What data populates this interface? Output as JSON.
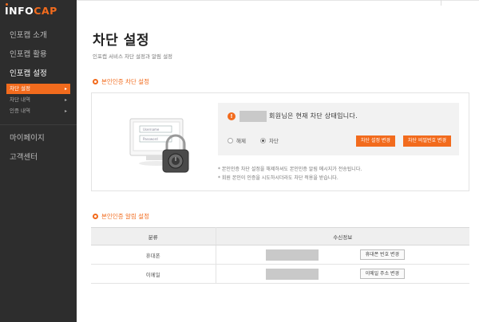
{
  "logo": {
    "prefix": "INFO",
    "suffix": "CAP"
  },
  "nav": {
    "items": [
      {
        "label": "인포캡 소개"
      },
      {
        "label": "인포캡 활용"
      },
      {
        "label": "인포캡 설정"
      }
    ],
    "sub_items": [
      {
        "label": "차단 설정",
        "arrow": "▸"
      },
      {
        "label": "차단 내역",
        "arrow": "▸"
      },
      {
        "label": "인증 내역",
        "arrow": "▸"
      }
    ],
    "bottom_items": [
      {
        "label": "마이페이지"
      },
      {
        "label": "고객센터"
      }
    ]
  },
  "page": {
    "title": "차단 설정",
    "subtitle": "인포캡 서비스 차단 설정과 알림 설정"
  },
  "block_section": {
    "title": "본인인증 차단 설정",
    "alert_icon": "!",
    "status_text": "회원님은 현재 차단 상태입니다.",
    "radio_release": "해제",
    "radio_block": "차단",
    "btn_change_setting": "차단 설정 변경",
    "btn_change_password": "차단 비밀번호 변경",
    "notes": [
      "* 본인인증 차단 설정을 해제하셔도 본인인증 알림 메시지가 전송됩니다.",
      "* 회원 본인이 인증을 시도하시더라도 차단 적용을 받습니다."
    ],
    "illus": {
      "username": "Username",
      "password": "Password"
    }
  },
  "alert_section": {
    "title": "본인인증 알림 설정",
    "col_type": "분류",
    "col_info": "수신정보",
    "rows": [
      {
        "type": "휴대폰",
        "button": "휴대폰 번호 변경"
      },
      {
        "type": "이메일",
        "button": "이메일 주소 변경"
      }
    ]
  },
  "colors": {
    "accent": "#f26b1d",
    "sidebar": "#2d2d2d"
  }
}
